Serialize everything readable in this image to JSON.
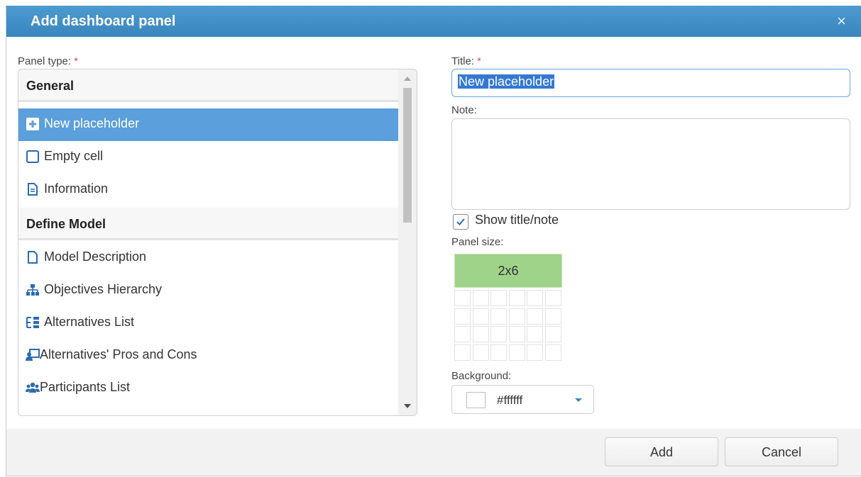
{
  "dialog": {
    "title": "Add dashboard panel",
    "close_glyph": "×"
  },
  "panel_type": {
    "label": "Panel type:",
    "required_mark": "*",
    "groups": [
      {
        "name": "General",
        "items": [
          {
            "label": "New placeholder",
            "icon": "plus-square-icon",
            "selected": true
          },
          {
            "label": "Empty cell",
            "icon": "square-outline-icon",
            "selected": false
          },
          {
            "label": "Information",
            "icon": "document-icon",
            "selected": false
          }
        ]
      },
      {
        "name": "Define Model",
        "items": [
          {
            "label": "Model Description",
            "icon": "file-icon",
            "selected": false
          },
          {
            "label": "Objectives Hierarchy",
            "icon": "hierarchy-icon",
            "selected": false
          },
          {
            "label": "Alternatives List",
            "icon": "list-icon",
            "selected": false
          },
          {
            "label": "Alternatives' Pros and Cons",
            "icon": "presentation-icon",
            "selected": false
          },
          {
            "label": "Participants List",
            "icon": "users-icon",
            "selected": false
          }
        ]
      }
    ]
  },
  "form": {
    "title_label": "Title:",
    "title_required_mark": "*",
    "title_value": "New placeholder",
    "note_label": "Note:",
    "note_value": "",
    "show_title_note_label": "Show title/note",
    "show_title_note_checked": true,
    "panel_size_label": "Panel size:",
    "panel_size_value": "2x6",
    "background_label": "Background:",
    "background_value": "#ffffff"
  },
  "footer": {
    "add_label": "Add",
    "cancel_label": "Cancel"
  },
  "colors": {
    "header": "#3a86be",
    "selected_item": "#5b9fdc",
    "panel_size_fill": "#9fd389",
    "required": "#d9534f"
  }
}
